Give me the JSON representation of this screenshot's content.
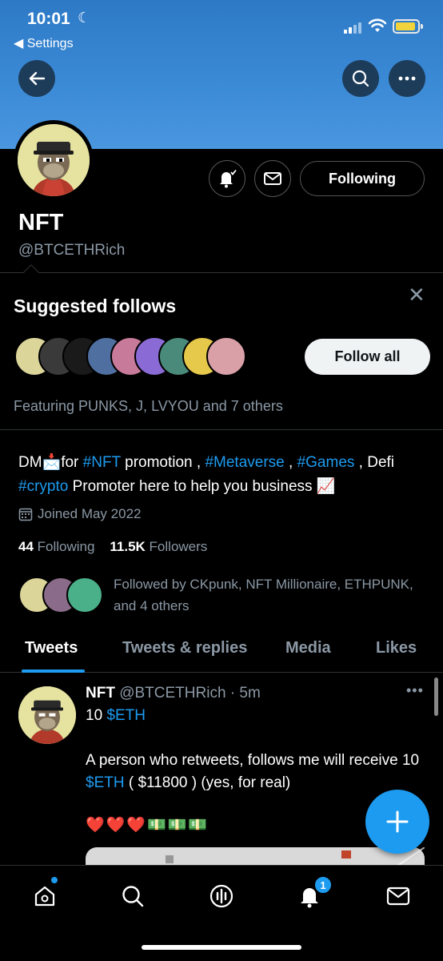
{
  "status_bar": {
    "time": "10:01",
    "back_app": "◀ Settings"
  },
  "profile": {
    "name": "NFT",
    "handle": "@BTCETHRich",
    "following_button": "Following",
    "bio_segments": [
      {
        "text": "DM📩for ",
        "tag": false
      },
      {
        "text": "#NFT",
        "tag": true
      },
      {
        "text": " promotion , ",
        "tag": false
      },
      {
        "text": "#Metaverse",
        "tag": true
      },
      {
        "text": " , ",
        "tag": false
      },
      {
        "text": "#Games",
        "tag": true
      },
      {
        "text": " , Defi ",
        "tag": false
      },
      {
        "text": "#crypto",
        "tag": true
      },
      {
        "text": " Promoter here to help you business 📈",
        "tag": false
      }
    ],
    "joined": "Joined May 2022",
    "following_count": "44",
    "following_label": "Following",
    "followers_count": "11.5K",
    "followers_label": "Followers",
    "followed_by": "Followed by CKpunk, NFT Millionaire, ETHPUNK, and 4 others"
  },
  "suggested": {
    "title": "Suggested follows",
    "follow_all": "Follow all",
    "featuring": "Featuring PUNKS, J, LVYOU and 7 others"
  },
  "tabs": [
    {
      "label": "Tweets",
      "active": true
    },
    {
      "label": "Tweets & replies",
      "active": false
    },
    {
      "label": "Media",
      "active": false
    },
    {
      "label": "Likes",
      "active": false
    }
  ],
  "tweet": {
    "name": "NFT",
    "handle_time": "@BTCETHRich · 5m",
    "more": "•••",
    "body_segments": [
      {
        "text": "10 ",
        "tag": false
      },
      {
        "text": "$ETH",
        "tag": true
      },
      {
        "text": "\n\nA person who retweets, follows me will receive 10 ",
        "tag": false
      },
      {
        "text": "$ETH",
        "tag": true
      },
      {
        "text": " ( $11800 ) (yes, for real)",
        "tag": false
      }
    ],
    "emoji_line": "❤️❤️❤️💵💵💵"
  },
  "bottom_nav": {
    "notification_badge": "1"
  },
  "colors": {
    "accent": "#1d9bf0",
    "banner": "#3b8ad6",
    "muted": "#8b98a5"
  }
}
